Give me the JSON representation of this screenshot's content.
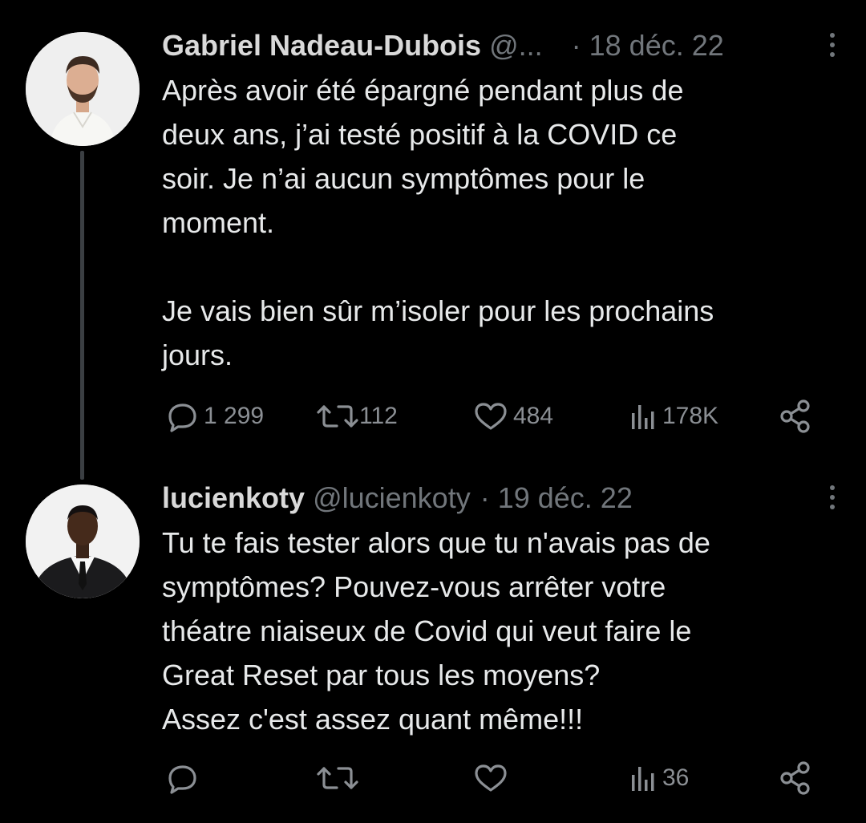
{
  "tweets": [
    {
      "display_name": "Gabriel Nadeau-Dubois",
      "handle": "@...",
      "separator": "·",
      "date": "18 déc. 22",
      "text": "Après avoir été épargné pendant plus de\ndeux ans, j’ai testé positif à la COVID ce\nsoir. Je n’ai aucun symptômes pour le\nmoment.\n\nJe vais bien sûr m’isoler pour les prochains\njours.",
      "replies": "1 299",
      "retweets": "112",
      "likes": "484",
      "views": "178K"
    },
    {
      "display_name": "lucienkoty",
      "handle": "@lucienkoty",
      "separator": "·",
      "date": "19 déc. 22",
      "text": "Tu te fais tester alors que tu n'avais pas de\nsymptômes? Pouvez-vous arrêter votre\nthéatre niaiseux de Covid qui veut faire le\nGreat Reset par tous les moyens?\nAssez c'est assez quant même!!!",
      "replies": "",
      "retweets": "",
      "likes": "",
      "views": "36"
    }
  ],
  "icons": {
    "reply": "reply-icon",
    "retweet": "retweet-icon",
    "like": "like-icon",
    "views": "views-icon",
    "share": "share-icon",
    "more": "more-icon"
  },
  "colors": {
    "background": "#000000",
    "text": "#e7e9ea",
    "secondary": "#71767b",
    "thread_line": "#3b3f43"
  }
}
